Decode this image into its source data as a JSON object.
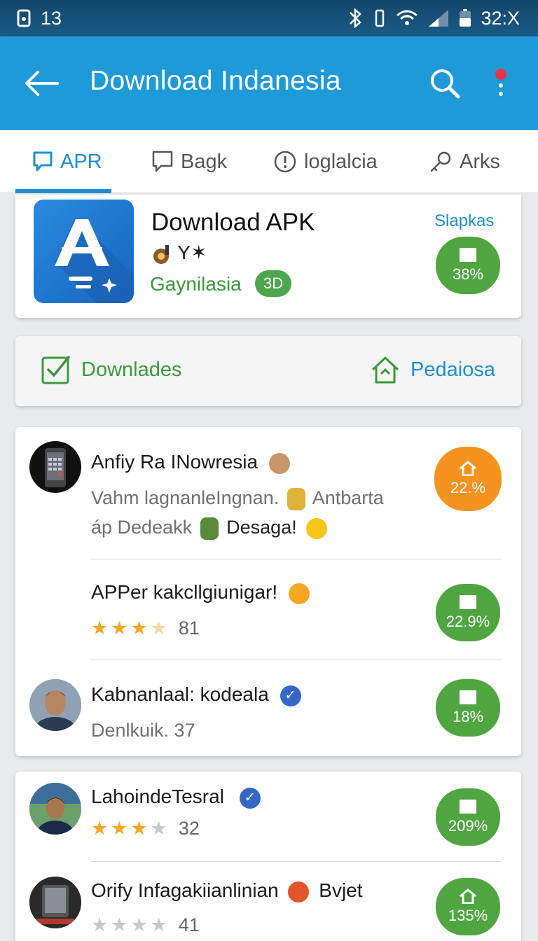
{
  "status_bar": {
    "time": "13",
    "battery": "32:X"
  },
  "app_bar": {
    "title": "Download Indanesia"
  },
  "tabs": [
    {
      "label": "APR",
      "icon": "chat-bubble-icon",
      "active": true
    },
    {
      "label": "Bagk",
      "icon": "chat-bubble-icon",
      "active": false
    },
    {
      "label": "loglalcia",
      "icon": "alert-circle-icon",
      "active": false
    },
    {
      "label": "Arks",
      "icon": "key-icon",
      "active": false
    }
  ],
  "app_card": {
    "name": "Download APK",
    "emoji_line": "Y✶",
    "developer": "Gaynilasia",
    "tag": "3D",
    "side_label": "Slapkas",
    "badge_percent": "38%"
  },
  "actions": {
    "left_label": "Downlades",
    "right_label": "Pedaiosa"
  },
  "list": [
    {
      "title": "Anfiy Ra INowresia",
      "sub1": "Vahm lagnanleIngnan.",
      "sub1b": "Antbarta",
      "sub2": "áp Dedeakk",
      "sub2b": "Desaga!",
      "badge": "22.%",
      "badge_color": "#f6921e"
    },
    {
      "title": "APPer kakcllgiunigar!",
      "rating": 3.5,
      "count": "81",
      "badge": "22.9%",
      "badge_color": "#4fa640"
    },
    {
      "title": "Kabnanlaal: kodeala",
      "sub1": "Denlkuik. 37",
      "badge": "18%",
      "badge_color": "#4fa640"
    }
  ],
  "list2": [
    {
      "title": "LahoindeTesral",
      "rating": 3,
      "count": "32",
      "badge": "209%",
      "badge_color": "#4fa640"
    },
    {
      "title": "Orify Infagakiianlinian",
      "title_b": "Bvjet",
      "rating": 0,
      "count": "41",
      "badge": "135%",
      "badge_color": "#4fa640"
    }
  ]
}
